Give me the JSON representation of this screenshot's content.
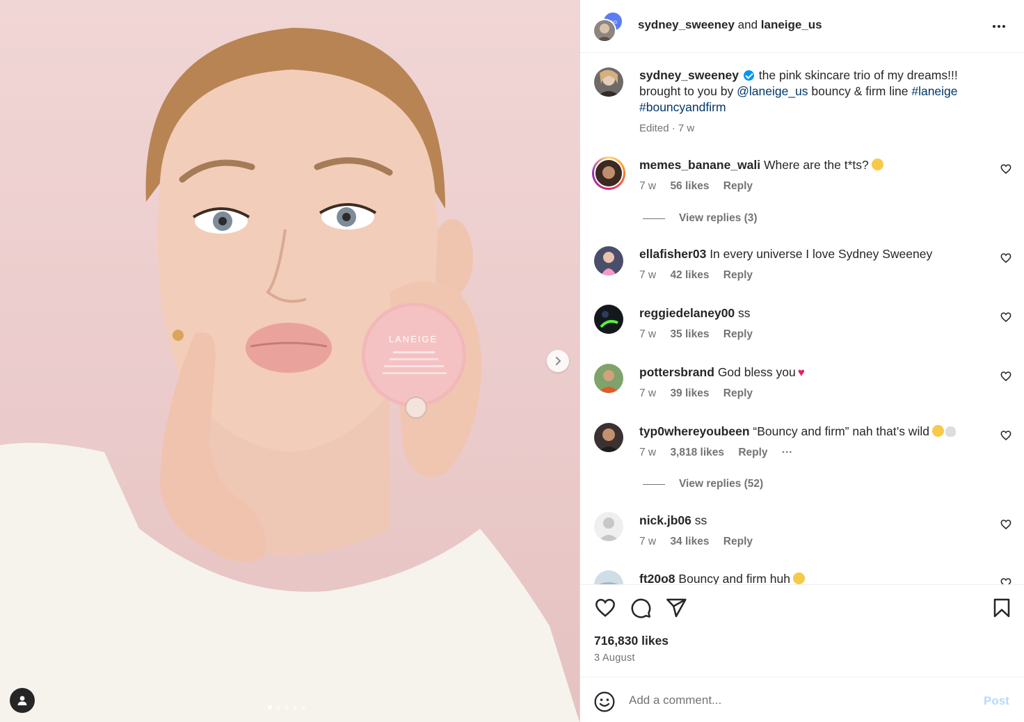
{
  "post": {
    "author": "sydney_sweeney",
    "collaborator": "laneige_us",
    "header_and": "and",
    "caption_user": "sydney_sweeney",
    "caption_part1": "the pink skincare trio of my dreams!!! brought to you by ",
    "caption_mention": "@laneige_us",
    "caption_part2": " bouncy & firm line ",
    "caption_tag1": "#laneige",
    "caption_tag2": "#bouncyandfirm",
    "caption_meta": "Edited · 7 w",
    "likes": "716,830 likes",
    "date": "3 August",
    "product_brand": "LANEIGE",
    "carousel_count": 5,
    "carousel_active_index": 0
  },
  "comments": [
    {
      "user": "memes_banane_wali",
      "text": "Where are the t*ts?",
      "emoji": "laughing-emoji",
      "time": "7 w",
      "likes": "56 likes",
      "reply": "Reply",
      "replies": "View replies (3)"
    },
    {
      "user": "ellafisher03",
      "text": "In every universe I love Sydney Sweeney",
      "time": "7 w",
      "likes": "42 likes",
      "reply": "Reply"
    },
    {
      "user": "reggiedelaney00",
      "text": "ss",
      "time": "7 w",
      "likes": "35 likes",
      "reply": "Reply"
    },
    {
      "user": "pottersbrand",
      "text": "God bless you",
      "emoji": "red-heart-emoji",
      "time": "7 w",
      "likes": "39 likes",
      "reply": "Reply"
    },
    {
      "user": "typ0whereyoubeen",
      "text": "“Bouncy and firm” nah that’s wild",
      "emoji": "crying-laughing-skull-emoji",
      "time": "7 w",
      "likes": "3,818 likes",
      "reply": "Reply",
      "more": "···",
      "replies": "View replies (52)"
    },
    {
      "user": "nick.jb06",
      "text": "ss",
      "time": "7 w",
      "likes": "34 likes",
      "reply": "Reply"
    },
    {
      "user": "ft20o8",
      "text": "Bouncy and firm huh",
      "emoji": "smirk-emoji"
    }
  ],
  "comment_box": {
    "placeholder": "Add a comment...",
    "post_label": "Post"
  },
  "colors": {
    "link": "#00376b",
    "verified": "#0095f6",
    "post_disabled": "#b3dbff",
    "background_pink": "#ebcbcb"
  }
}
